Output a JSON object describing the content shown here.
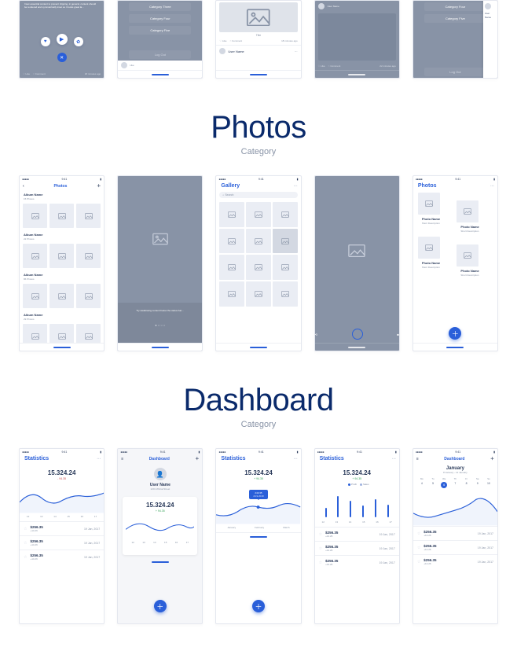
{
  "row1": {
    "s1": {
      "blurb": "Inset essential content to prevent clipping, in general, content should be rendered and symmetrically inset so it looks great la…",
      "like": "Like",
      "comment": "Comment",
      "time": "18 minutes ago"
    },
    "s2": {
      "categories": [
        "Category Three",
        "Category Four",
        "Category Five"
      ],
      "logout": "Log Out",
      "barLike": "Like"
    },
    "s3": {
      "label": "Title",
      "like": "Like",
      "comment": "Comment",
      "time": "18 minutes ago",
      "user": "User Name"
    },
    "s4": {
      "user": "User Name",
      "like": "Like",
      "comment": "Comment",
      "time": "22 minutes ago"
    },
    "s5": {
      "categories": [
        "Category Four",
        "Category Five"
      ],
      "logout": "Log Out",
      "user": "User Name"
    }
  },
  "photos": {
    "section_title": "Photos",
    "section_sub": "Category",
    "time": "9:41",
    "s1": {
      "title": "Photos",
      "albums": [
        {
          "name": "Album Name",
          "count": "15 Photos"
        },
        {
          "name": "Album Name",
          "count": "22 Photos"
        },
        {
          "name": "Album Name",
          "count": "86 Photos"
        },
        {
          "name": "Album Name",
          "count": "29 Photos"
        }
      ]
    },
    "s2": {
      "caption": "Try swallowing content below the status bar…"
    },
    "s3": {
      "title": "Gallery",
      "search_ph": "Search"
    },
    "s5": {
      "title": "Photos",
      "items": [
        {
          "name": "Photo Name",
          "desc": "Short Description"
        },
        {
          "name": "Photo Name",
          "desc": "Short Description"
        },
        {
          "name": "Photo Name",
          "desc": "Short Description"
        },
        {
          "name": "Photo Name",
          "desc": "Short Description"
        }
      ]
    }
  },
  "dash": {
    "section_title": "Dashboard",
    "section_sub": "Category",
    "time": "9:41",
    "stats_title": "Statistics",
    "dash_title": "Dashboard",
    "big": "15.324.24",
    "delta_up": "+ 94.35",
    "delta_down": "- 94.35",
    "list": [
      {
        "amt": "$256.35",
        "sub": "+14.26",
        "date": "19 Jan, 2017"
      },
      {
        "amt": "$256.35",
        "sub": "+14.26",
        "date": "19 Jan, 2017"
      },
      {
        "amt": "$256.35",
        "sub": "+14.26",
        "date": "19 Jan, 2017"
      }
    ],
    "axis_nums": [
      "12",
      "13",
      "14",
      "15",
      "16",
      "17"
    ],
    "months": [
      "January",
      "February",
      "March"
    ],
    "legend": {
      "a": "Profit",
      "b": "Sales"
    },
    "s2": {
      "user": "User Name",
      "sub": "1201 WintonStreet"
    },
    "s3_callout": {
      "top": "243.35",
      "bottom": "24.9.2018"
    },
    "s5": {
      "month": "January",
      "range": "8 January - 12 January",
      "dow": [
        "Mo",
        "Tu",
        "We",
        "Th",
        "Fr",
        "Sa",
        "Su"
      ],
      "days": [
        "4",
        "5",
        "6",
        "7",
        "8",
        "9",
        "10"
      ],
      "sel": 2
    }
  },
  "chart_data": {
    "type": "bar",
    "title": "Statistics",
    "categories": [
      "12",
      "13",
      "14",
      "15",
      "16",
      "17"
    ],
    "values": [
      22,
      50,
      40,
      28,
      44,
      30
    ],
    "ylim": [
      0,
      60
    ]
  }
}
